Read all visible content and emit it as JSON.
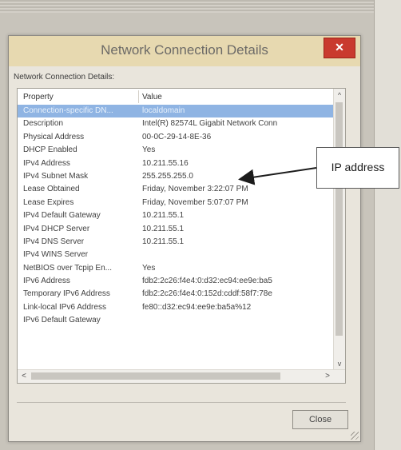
{
  "dialog": {
    "title": "Network Connection Details",
    "close_glyph": "✕",
    "group_label": "Network Connection Details:",
    "columns": {
      "property": "Property",
      "value": "Value"
    },
    "rows": [
      {
        "property": "Connection-specific DN...",
        "value": "localdomain",
        "selected": true
      },
      {
        "property": "Description",
        "value": "Intel(R) 82574L Gigabit Network Conn"
      },
      {
        "property": "Physical Address",
        "value": "00-0C-29-14-8E-36"
      },
      {
        "property": "DHCP Enabled",
        "value": "Yes"
      },
      {
        "property": "IPv4 Address",
        "value": "10.211.55.16"
      },
      {
        "property": "IPv4 Subnet Mask",
        "value": "255.255.255.0"
      },
      {
        "property": "Lease Obtained",
        "value": "Friday, November 3:22:07 PM"
      },
      {
        "property": "Lease Expires",
        "value": "Friday, November 5:07:07 PM"
      },
      {
        "property": "IPv4 Default Gateway",
        "value": "10.211.55.1"
      },
      {
        "property": "IPv4 DHCP Server",
        "value": "10.211.55.1"
      },
      {
        "property": "IPv4 DNS Server",
        "value": "10.211.55.1"
      },
      {
        "property": "IPv4 WINS Server",
        "value": ""
      },
      {
        "property": "NetBIOS over Tcpip En...",
        "value": "Yes"
      },
      {
        "property": "IPv6 Address",
        "value": "fdb2:2c26:f4e4:0:d32:ec94:ee9e:ba5"
      },
      {
        "property": "Temporary IPv6 Address",
        "value": "fdb2:2c26:f4e4:0:152d:cddf:58f7:78e"
      },
      {
        "property": "Link-local IPv6 Address",
        "value": "fe80::d32:ec94:ee9e:ba5a%12"
      },
      {
        "property": "IPv6 Default Gateway",
        "value": ""
      }
    ],
    "scroll": {
      "up": "^",
      "down": "v",
      "left": "<",
      "right": ">"
    },
    "close_button": "Close"
  },
  "callout": {
    "label": "IP address"
  },
  "colors": {
    "selection": "#8fb4e3",
    "close_red": "#c93a2e",
    "titlebar": "#e7d9b0"
  }
}
